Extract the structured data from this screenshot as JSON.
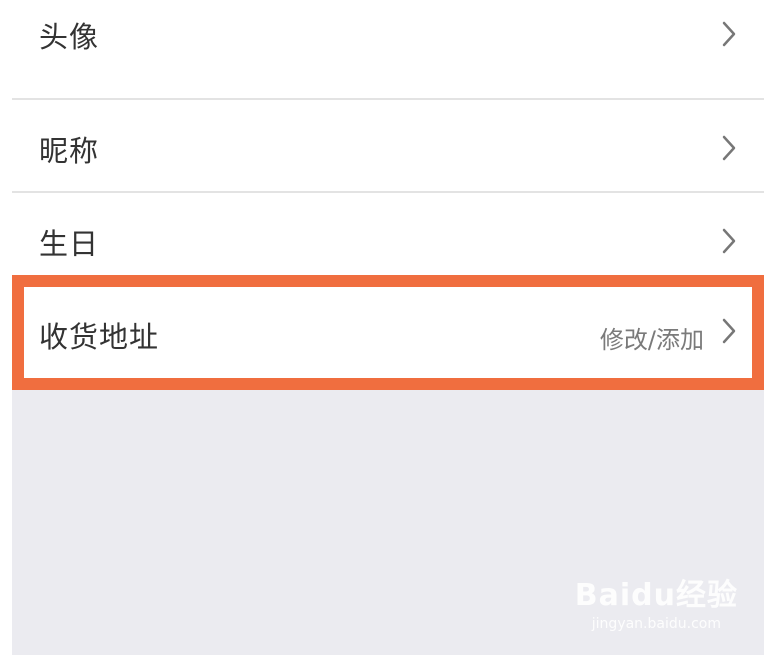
{
  "profile_rows": [
    {
      "label": "头像"
    },
    {
      "label": "昵称"
    },
    {
      "label": "生日"
    },
    {
      "label": "收货地址",
      "value": "修改/添加"
    }
  ],
  "colors": {
    "highlight_border": "#f06e3f",
    "divider": "#e3e3e3",
    "background_grey": "#ebebf0"
  },
  "watermark": {
    "logo": "Baidu经验",
    "url": "jingyan.baidu.com"
  }
}
